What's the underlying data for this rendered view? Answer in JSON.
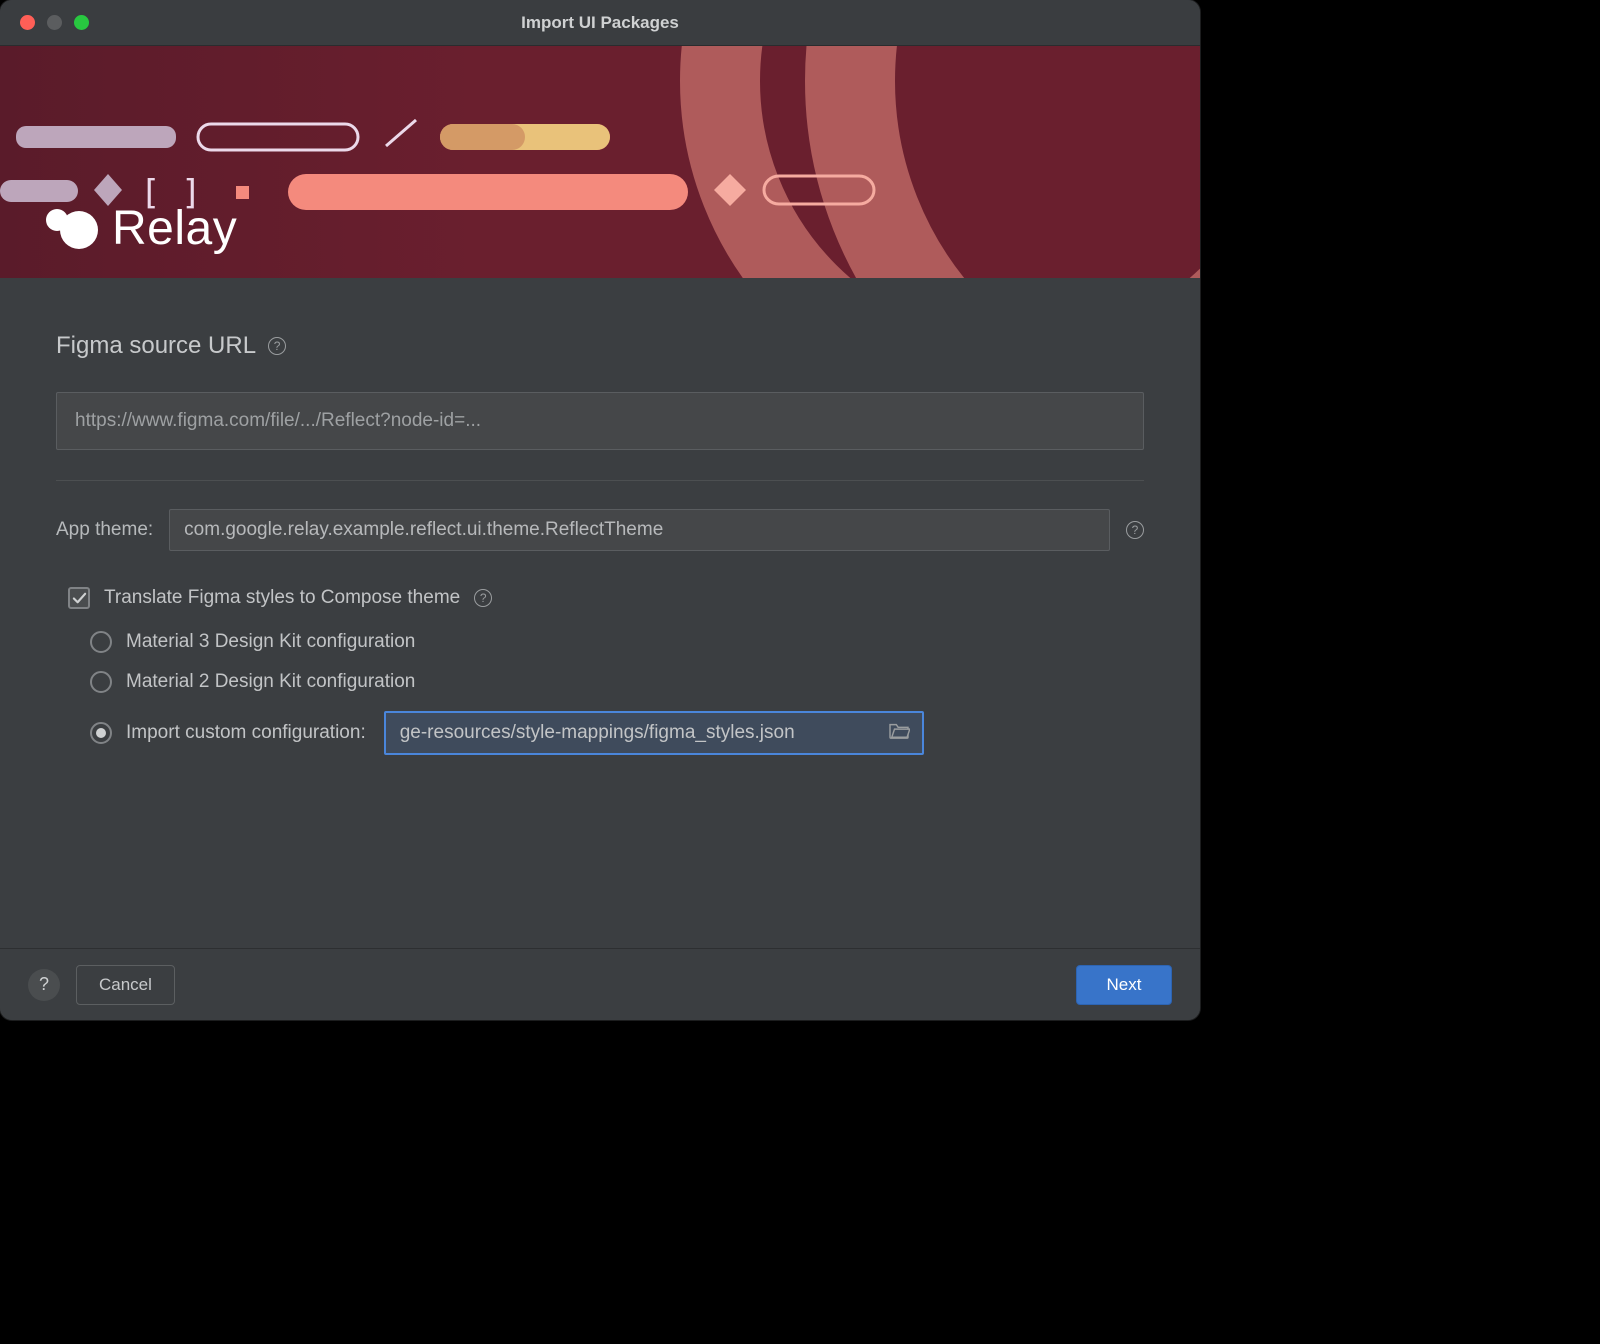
{
  "window": {
    "title": "Import UI Packages"
  },
  "banner": {
    "product": "Relay"
  },
  "section": {
    "figma_label": "Figma source URL",
    "figma_placeholder": "https://www.figma.com/file/.../Reflect?node-id=..."
  },
  "theme": {
    "label": "App theme:",
    "value": "com.google.relay.example.reflect.ui.theme.ReflectTheme"
  },
  "translate": {
    "checkbox_label": "Translate Figma styles to Compose theme",
    "options": {
      "m3": "Material 3 Design Kit configuration",
      "m2": "Material 2 Design Kit configuration",
      "custom": "Import custom configuration:"
    },
    "custom_path": "ge-resources/style-mappings/figma_styles.json"
  },
  "footer": {
    "cancel": "Cancel",
    "next": "Next"
  }
}
